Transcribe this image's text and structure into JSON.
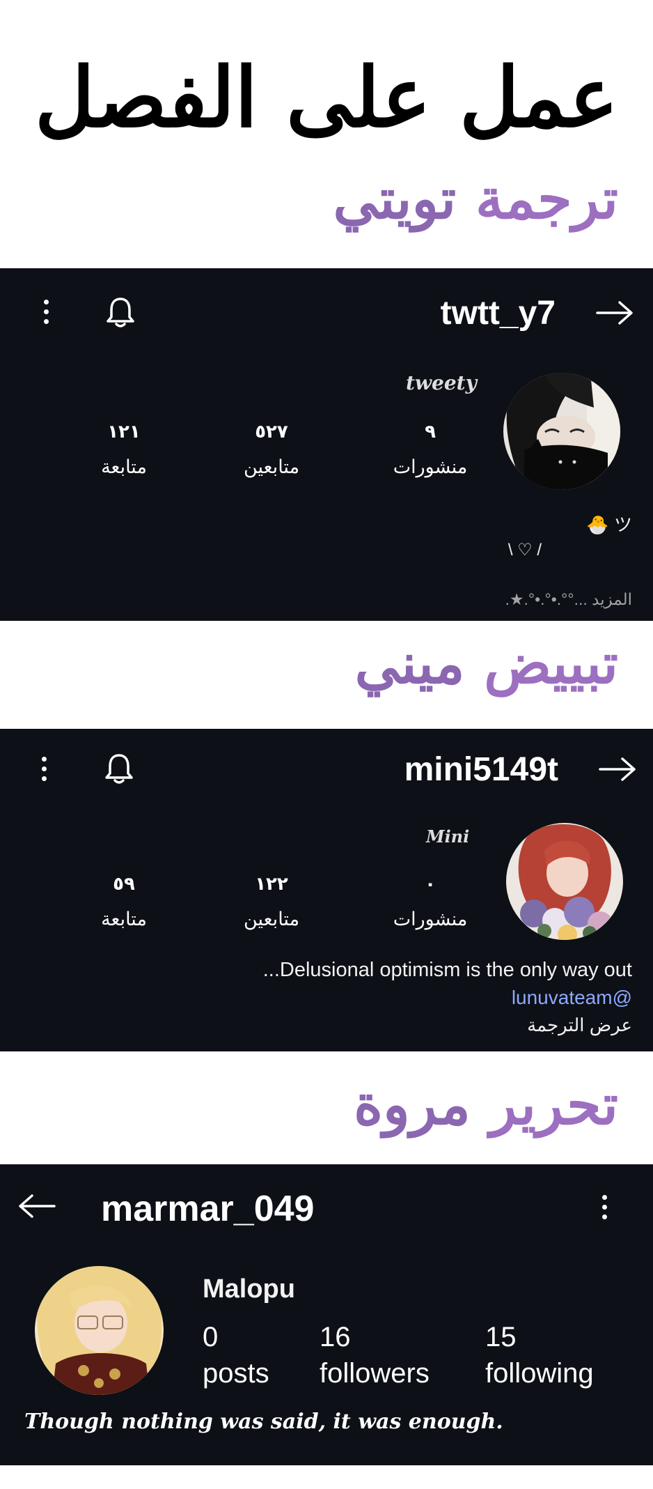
{
  "page_title": "عمل على الفصل",
  "credits": [
    {
      "role": "ترجمة",
      "name": "تويتي"
    },
    {
      "role": "تبييض",
      "name": "ميني"
    },
    {
      "role": "تحرير",
      "name": "مروة"
    }
  ],
  "profiles": [
    {
      "username": "twtt_y7",
      "nickname": "tweety",
      "stats": [
        {
          "value": "٩",
          "label": "منشورات"
        },
        {
          "value": "٥٢٧",
          "label": "متابعين"
        },
        {
          "value": "١٢١",
          "label": "متابعة"
        }
      ],
      "bio_line1": "🐣 ツ",
      "bio_line2": "\\ ♡ /",
      "bio_line3": ".★.°•.°•.°°... المزيد"
    },
    {
      "username": "mini5149t",
      "nickname": "Mini",
      "stats": [
        {
          "value": "٠",
          "label": "منشورات"
        },
        {
          "value": "١٢٢",
          "label": "متابعين"
        },
        {
          "value": "٥٩",
          "label": "متابعة"
        }
      ],
      "bio_line1": "...Delusional optimism is the only way out",
      "bio_link": "lunuvateam@",
      "translate_label": "عرض الترجمة"
    },
    {
      "username": "marmar_049",
      "display_name": "Malopu",
      "stats": [
        {
          "value": "0",
          "label": "posts"
        },
        {
          "value": "16",
          "label": "followers"
        },
        {
          "value": "15",
          "label": "following"
        }
      ],
      "quote": "Though nothing was said, it was enough."
    }
  ]
}
